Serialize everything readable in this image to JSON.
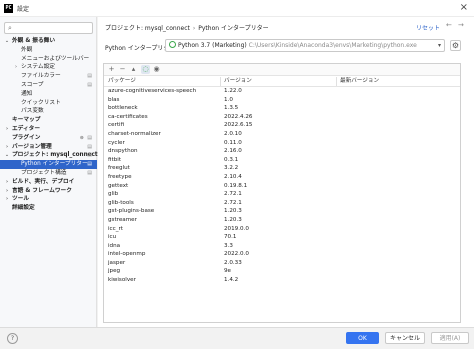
{
  "window": {
    "title": "設定",
    "app_icon": "PC"
  },
  "sidebar": {
    "search_placeholder": "",
    "items": [
      {
        "label": "外観 & 振る舞い",
        "level": 0,
        "expanded": true,
        "bold": true
      },
      {
        "label": "外観",
        "level": 1
      },
      {
        "label": "メニューおよびツールバー",
        "level": 1
      },
      {
        "label": "システム設定",
        "level": 1,
        "collapsed": true
      },
      {
        "label": "ファイルカラー",
        "level": 1,
        "badge": true
      },
      {
        "label": "スコープ",
        "level": 1,
        "badge": true
      },
      {
        "label": "通知",
        "level": 1
      },
      {
        "label": "クイックリスト",
        "level": 1
      },
      {
        "label": "パス変数",
        "level": 1
      },
      {
        "label": "キーマップ",
        "level": 0,
        "bold": true
      },
      {
        "label": "エディター",
        "level": 0,
        "collapsed": true,
        "bold": true
      },
      {
        "label": "プラグイン",
        "level": 0,
        "bold": true,
        "badge": true,
        "badge2": true
      },
      {
        "label": "バージョン管理",
        "level": 0,
        "collapsed": true,
        "bold": true,
        "badge": true
      },
      {
        "label": "プロジェクト: mysql_connect",
        "level": 0,
        "expanded": true,
        "bold": true,
        "badge": true
      },
      {
        "label": "Python インタープリター",
        "level": 1,
        "selected": true,
        "badge": true
      },
      {
        "label": "プロジェクト構造",
        "level": 1,
        "badge": true
      },
      {
        "label": "ビルド、実行、デプロイ",
        "level": 0,
        "collapsed": true,
        "bold": true
      },
      {
        "label": "言語 & フレームワーク",
        "level": 0,
        "collapsed": true,
        "bold": true
      },
      {
        "label": "ツール",
        "level": 0,
        "collapsed": true,
        "bold": true
      },
      {
        "label": "詳細設定",
        "level": 0,
        "bold": true
      }
    ]
  },
  "main": {
    "breadcrumb": [
      "プロジェクト: mysql_connect",
      "Python インタープリター"
    ],
    "reset_label": "リセット",
    "interpreter_label": "Python インタープリター:",
    "interpreter_name": "Python 3.7 (Marketing)",
    "interpreter_path": "C:\\Users\\Kinside\\Anaconda3\\envs\\Marketing\\python.exe",
    "columns": [
      "パッケージ",
      "バージョン",
      "最新バージョン"
    ],
    "packages": [
      {
        "name": "azure-cognitiveservices-speech",
        "version": "1.22.0",
        "latest": ""
      },
      {
        "name": "blas",
        "version": "1.0",
        "latest": ""
      },
      {
        "name": "bottleneck",
        "version": "1.3.5",
        "latest": ""
      },
      {
        "name": "ca-certificates",
        "version": "2022.4.26",
        "latest": ""
      },
      {
        "name": "certifi",
        "version": "2022.6.15",
        "latest": ""
      },
      {
        "name": "charset-normalizer",
        "version": "2.0.10",
        "latest": ""
      },
      {
        "name": "cycler",
        "version": "0.11.0",
        "latest": ""
      },
      {
        "name": "dnspython",
        "version": "2.16.0",
        "latest": ""
      },
      {
        "name": "fitbit",
        "version": "0.3.1",
        "latest": ""
      },
      {
        "name": "freeglut",
        "version": "3.2.2",
        "latest": ""
      },
      {
        "name": "freetype",
        "version": "2.10.4",
        "latest": ""
      },
      {
        "name": "gettext",
        "version": "0.19.8.1",
        "latest": ""
      },
      {
        "name": "glib",
        "version": "2.72.1",
        "latest": ""
      },
      {
        "name": "glib-tools",
        "version": "2.72.1",
        "latest": ""
      },
      {
        "name": "gst-plugins-base",
        "version": "1.20.3",
        "latest": ""
      },
      {
        "name": "gstreamer",
        "version": "1.20.3",
        "latest": ""
      },
      {
        "name": "icc_rt",
        "version": "2019.0.0",
        "latest": ""
      },
      {
        "name": "icu",
        "version": "70.1",
        "latest": ""
      },
      {
        "name": "idna",
        "version": "3.3",
        "latest": ""
      },
      {
        "name": "intel-openmp",
        "version": "2022.0.0",
        "latest": ""
      },
      {
        "name": "jasper",
        "version": "2.0.33",
        "latest": ""
      },
      {
        "name": "jpeg",
        "version": "9e",
        "latest": ""
      },
      {
        "name": "kiwisolver",
        "version": "1.4.2",
        "latest": ""
      }
    ]
  },
  "footer": {
    "help": "?",
    "ok_label": "OK",
    "cancel_label": "キャンセル",
    "apply_label": "適用(A)"
  },
  "colors": {
    "accent": "#3574f0",
    "selection": "#2f65ca",
    "python_green": "#3aa84b"
  }
}
